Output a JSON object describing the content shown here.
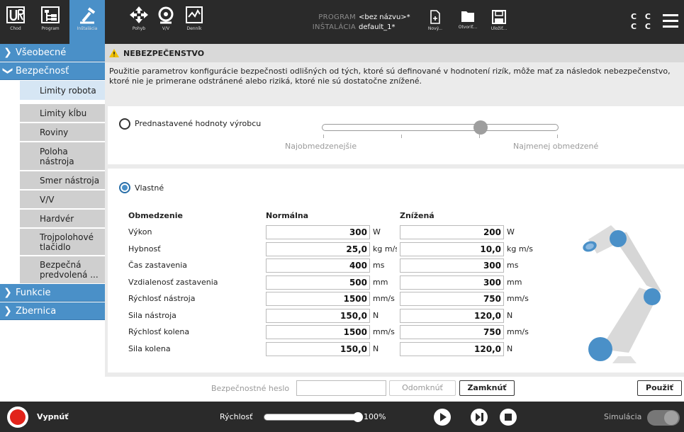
{
  "topbar": {
    "nav": [
      {
        "label": "Chod",
        "icon": "ur-logo-icon"
      },
      {
        "label": "Program",
        "icon": "program-icon"
      },
      {
        "label": "Inštalácia",
        "icon": "installation-icon"
      },
      {
        "label": "Pohyb",
        "icon": "move-icon"
      },
      {
        "label": "V/V",
        "icon": "io-icon"
      },
      {
        "label": "Denník",
        "icon": "log-icon"
      }
    ],
    "program_key": "PROGRAM",
    "program_value": "<bez názvu>*",
    "installation_key": "INŠTALÁCIA",
    "installation_value": "default_1*",
    "file_buttons": [
      {
        "label": "Nový...",
        "icon": "new-file-icon"
      },
      {
        "label": "Otvoriť...",
        "icon": "open-folder-icon"
      },
      {
        "label": "Uložiť...",
        "icon": "save-icon"
      }
    ],
    "cc_line1": "C C",
    "cc_line2": "C C"
  },
  "sidebar": {
    "sections": [
      {
        "label": "Všeobecné",
        "expanded": false
      },
      {
        "label": "Bezpečnosť",
        "expanded": true
      },
      {
        "label": "Funkcie",
        "expanded": false
      },
      {
        "label": "Zbernica",
        "expanded": false
      }
    ],
    "items": [
      {
        "label": "Limity robota",
        "selected": true
      },
      {
        "label": "Limity kĺbu"
      },
      {
        "label": "Roviny"
      },
      {
        "label": "Poloha nástroja"
      },
      {
        "label": "Smer nástroja"
      },
      {
        "label": "V/V"
      },
      {
        "label": "Hardvér"
      },
      {
        "label": "Trojpolohové tlačidlo"
      },
      {
        "label": "Bezpečná predvolená ..."
      }
    ]
  },
  "warning": {
    "title": "NEBEZPEČENSTVO",
    "text": "Použitie parametrov konfigurácie bezpečnosti odlišných od tých, ktoré sú definované v hodnotení rizík, môže mať za následok nebezpečenstvo, ktoré nie je primerane odstránené alebo riziká, ktoré nie sú dostatočne znížené."
  },
  "preset": {
    "label": "Prednastavené hodnoty výrobcu",
    "left_label": "Najobmedzenejšie",
    "right_label": "Najmenej obmedzené",
    "slider_position": 0.67
  },
  "custom": {
    "label": "Vlastné",
    "selected": true
  },
  "table": {
    "headers": [
      "Obmedzenie",
      "Normálna",
      "Znížená"
    ],
    "rows": [
      {
        "name": "Výkon",
        "normal": "300",
        "normal_unit": "W",
        "reduced": "200",
        "reduced_unit": "W"
      },
      {
        "name": "Hybnosť",
        "normal": "25,0",
        "normal_unit": "kg m/s",
        "reduced": "10,0",
        "reduced_unit": "kg m/s"
      },
      {
        "name": "Čas zastavenia",
        "normal": "400",
        "normal_unit": "ms",
        "reduced": "300",
        "reduced_unit": "ms"
      },
      {
        "name": "Vzdialenosť zastavenia",
        "normal": "500",
        "normal_unit": "mm",
        "reduced": "300",
        "reduced_unit": "mm"
      },
      {
        "name": "Rýchlosť nástroja",
        "normal": "1500",
        "normal_unit": "mm/s",
        "reduced": "750",
        "reduced_unit": "mm/s"
      },
      {
        "name": "Sila nástroja",
        "normal": "150,0",
        "normal_unit": "N",
        "reduced": "120,0",
        "reduced_unit": "N"
      },
      {
        "name": "Rýchlosť kolena",
        "normal": "1500",
        "normal_unit": "mm/s",
        "reduced": "750",
        "reduced_unit": "mm/s"
      },
      {
        "name": "Sila kolena",
        "normal": "150,0",
        "normal_unit": "N",
        "reduced": "120,0",
        "reduced_unit": "N"
      }
    ]
  },
  "bottom": {
    "password_label": "Bezpečnostné heslo",
    "password_value": "",
    "unlock_label": "Odomknúť",
    "lock_label": "Zamknúť",
    "apply_label": "Použiť"
  },
  "footer": {
    "power_label": "Vypnúť",
    "speed_label": "Rýchlosť",
    "speed_value": "100%",
    "speed_fraction": 1.0,
    "simulation_label": "Simulácia",
    "colors": {
      "power": "#e2231a",
      "accent": "#4a90c8"
    }
  }
}
